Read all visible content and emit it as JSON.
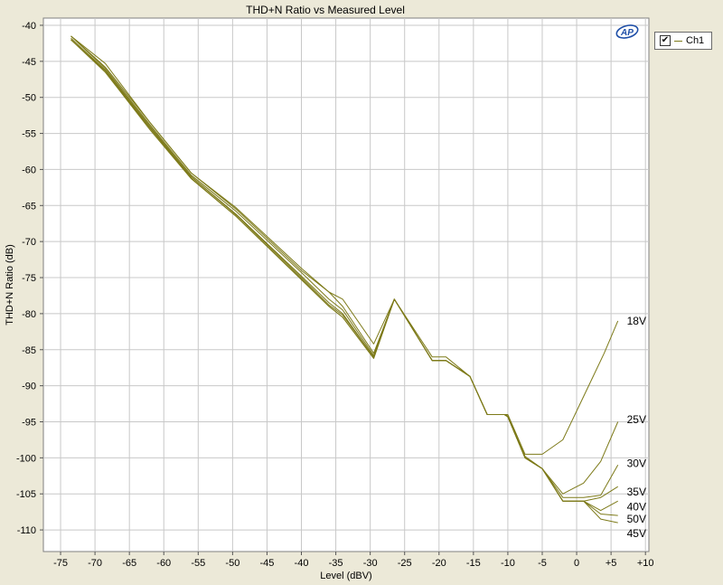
{
  "chart_data": {
    "type": "line",
    "title": "THD+N Ratio vs Measured Level",
    "xlabel": "Level (dBV)",
    "ylabel": "THD+N Ratio (dB)",
    "xlim": [
      -77.5,
      10.5
    ],
    "ylim": [
      -113,
      -39
    ],
    "xticks": [
      -75,
      -70,
      -65,
      -60,
      -55,
      -50,
      -45,
      -40,
      -35,
      -30,
      -25,
      -20,
      -15,
      -10,
      -5,
      0,
      5,
      10
    ],
    "xtick_labels": [
      "-75",
      "-70",
      "-65",
      "-60",
      "-55",
      "-50",
      "-45",
      "-40",
      "-35",
      "-30",
      "-25",
      "-20",
      "-15",
      "-10",
      "-5",
      "0",
      "+5",
      "+10"
    ],
    "yticks": [
      -40,
      -45,
      -50,
      -55,
      -60,
      -65,
      -70,
      -75,
      -80,
      -85,
      -90,
      -95,
      -100,
      -105,
      -110
    ],
    "ytick_labels": [
      "-40",
      "-45",
      "-50",
      "-55",
      "-60",
      "-65",
      "-70",
      "-75",
      "-80",
      "-85",
      "-90",
      "-95",
      "-100",
      "-105",
      "-110"
    ],
    "grid": true,
    "line_color": "#7d7a19",
    "series": [
      {
        "name": "18V",
        "x": [
          -73.5,
          -68.5,
          -62,
          -56,
          -49.5,
          -40,
          -36,
          -34,
          -29.5,
          -26.5,
          -21,
          -19,
          -15.5,
          -13,
          -10.5,
          -10,
          -7.5,
          -5,
          -2,
          0,
          2,
          4,
          6
        ],
        "y": [
          -41.5,
          -45.3,
          -53.5,
          -60.5,
          -65.3,
          -73.7,
          -77,
          -78,
          -84.2,
          -78,
          -86,
          -86,
          -88.7,
          -94,
          -94,
          -94,
          -99.5,
          -99.5,
          -97.5,
          -93.5,
          -89.5,
          -85.5,
          -81
        ]
      },
      {
        "name": "25V",
        "x": [
          -73.5,
          -68.5,
          -62,
          -56,
          -49.5,
          -40,
          -36,
          -34,
          -29.5,
          -26.5,
          -21,
          -19,
          -15.5,
          -13,
          -10.5,
          -10,
          -7.5,
          -5,
          -2,
          1,
          3.5,
          6
        ],
        "y": [
          -41.5,
          -45.8,
          -53.5,
          -60.5,
          -65.5,
          -74,
          -77,
          -79,
          -85.5,
          -78,
          -86.5,
          -86.5,
          -88.7,
          -94,
          -94,
          -94.2,
          -99.8,
          -101.5,
          -105,
          -103.5,
          -100.5,
          -95
        ]
      },
      {
        "name": "30V",
        "x": [
          -73.5,
          -68.5,
          -62,
          -56,
          -49.5,
          -40,
          -36,
          -34,
          -29.5,
          -26.5,
          -21,
          -19,
          -15.5,
          -13,
          -10.5,
          -10,
          -7.5,
          -5,
          -2,
          1,
          3.5,
          6
        ],
        "y": [
          -41.5,
          -46,
          -53.8,
          -60.8,
          -65.8,
          -74.3,
          -78,
          -79.5,
          -85.8,
          -78,
          -86.5,
          -86.5,
          -88.7,
          -94,
          -94,
          -94.3,
          -100,
          -101.5,
          -105.5,
          -105.5,
          -105.2,
          -101
        ]
      },
      {
        "name": "35V",
        "x": [
          -73.5,
          -68.5,
          -62,
          -56,
          -49.5,
          -40,
          -36,
          -34,
          -29.5,
          -26.5,
          -21,
          -19,
          -15.5,
          -13,
          -10.5,
          -10,
          -7.5,
          -5,
          -2,
          1,
          3.5,
          6
        ],
        "y": [
          -41.8,
          -46.2,
          -54,
          -61,
          -66.2,
          -74.8,
          -78.5,
          -80,
          -86,
          -78,
          -86.5,
          -86.5,
          -88.7,
          -94,
          -94,
          -94.3,
          -100,
          -101.5,
          -106,
          -106,
          -105.5,
          -104
        ]
      },
      {
        "name": "40V",
        "x": [
          -73.5,
          -68.5,
          -62,
          -56,
          -49.5,
          -40,
          -36,
          -34,
          -29.5,
          -26.5,
          -21,
          -19,
          -15.5,
          -13,
          -10.5,
          -10,
          -7.5,
          -5,
          -2,
          1,
          3.5,
          6
        ],
        "y": [
          -42,
          -46.3,
          -54.2,
          -61,
          -66.3,
          -75,
          -78.8,
          -80.2,
          -86,
          -78,
          -86.5,
          -86.5,
          -88.7,
          -94,
          -94,
          -94.3,
          -100,
          -101.5,
          -106,
          -106,
          -107.3,
          -106
        ]
      },
      {
        "name": "50V",
        "x": [
          -73.5,
          -68.5,
          -62,
          -56,
          -49.5,
          -40,
          -36,
          -34,
          -29.5,
          -26.5,
          -21,
          -19,
          -15.5,
          -13,
          -10.5,
          -10,
          -7.5,
          -5,
          -2,
          1,
          3.5,
          6
        ],
        "y": [
          -42,
          -46.5,
          -54.3,
          -61.2,
          -66.5,
          -75.2,
          -79,
          -80.5,
          -86.2,
          -78,
          -86.5,
          -86.5,
          -88.7,
          -94,
          -94,
          -94.3,
          -100,
          -101.5,
          -106,
          -106,
          -107.8,
          -108
        ]
      },
      {
        "name": "45V",
        "x": [
          -73.5,
          -68.5,
          -62,
          -56,
          -49.5,
          -40,
          -36,
          -34,
          -29.5,
          -26.5,
          -21,
          -19,
          -15.5,
          -13,
          -10.5,
          -10,
          -7.5,
          -5,
          -2,
          1,
          3.5,
          6
        ],
        "y": [
          -42,
          -46.5,
          -54.5,
          -61.3,
          -66.5,
          -75.3,
          -79,
          -80.5,
          -86.2,
          -78,
          -86.5,
          -86.5,
          -88.7,
          -94,
          -94,
          -94.3,
          -100,
          -101.5,
          -106,
          -106,
          -108.5,
          -109
        ]
      }
    ],
    "annotations": [
      {
        "text": "18V",
        "x": 7.3,
        "y": -81
      },
      {
        "text": "25V",
        "x": 7.3,
        "y": -94.7
      },
      {
        "text": "30V",
        "x": 7.3,
        "y": -100.8
      },
      {
        "text": "35V",
        "x": 7.3,
        "y": -104.7
      },
      {
        "text": "40V",
        "x": 7.3,
        "y": -106.8
      },
      {
        "text": "50V",
        "x": 7.3,
        "y": -108.5
      },
      {
        "text": "45V",
        "x": 7.3,
        "y": -110.5
      }
    ]
  },
  "legend": {
    "checked_glyph": "✔",
    "label": "Ch1"
  },
  "logo": {
    "text": "AP",
    "icon": "ap-logo-icon"
  }
}
